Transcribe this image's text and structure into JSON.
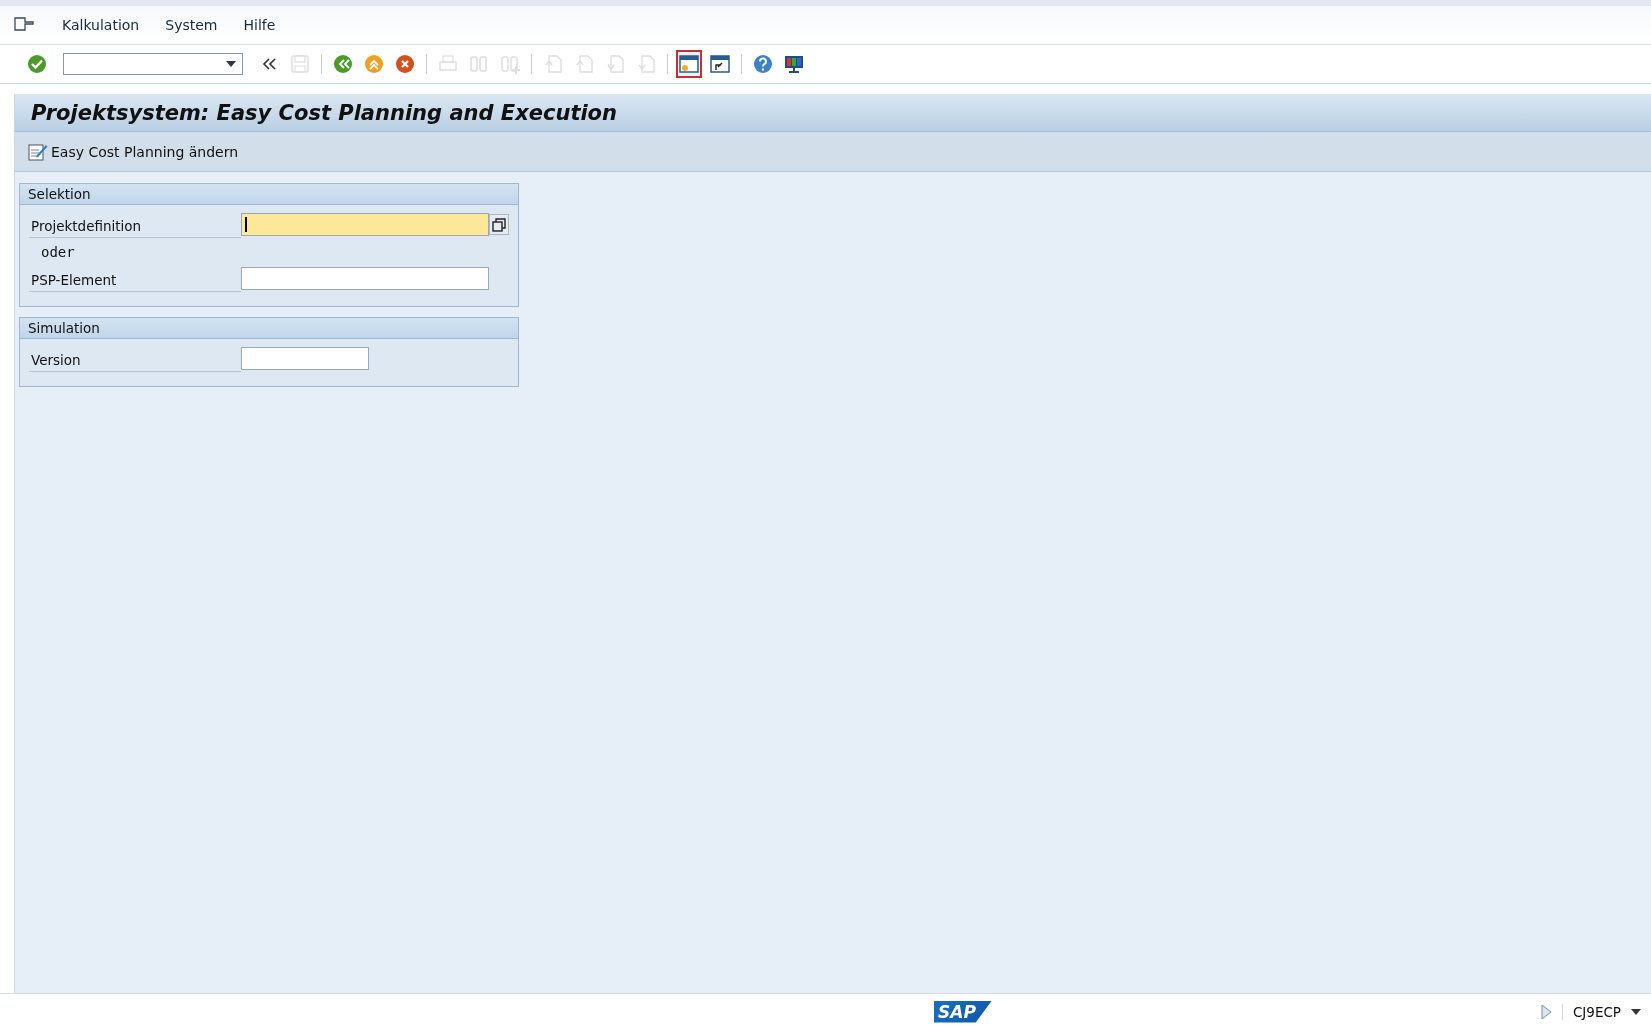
{
  "menu": [
    {
      "label": "Kalkulation"
    },
    {
      "label": "System"
    },
    {
      "label": "Hilfe"
    }
  ],
  "toolbar": [
    {
      "buttons": [
        {
          "kind": "enter",
          "disabled": false,
          "focused": false
        }
      ]
    },
    {
      "buttons": [
        {
          "kind": "collapse",
          "disabled": false,
          "focused": false
        },
        {
          "kind": "save",
          "disabled": true,
          "focused": false
        }
      ]
    },
    {
      "buttons": [
        {
          "kind": "back",
          "disabled": false,
          "focused": false
        },
        {
          "kind": "exit",
          "disabled": false,
          "focused": false
        },
        {
          "kind": "cancel",
          "disabled": false,
          "focused": false
        }
      ]
    },
    {
      "buttons": [
        {
          "kind": "print",
          "disabled": true,
          "focused": false
        },
        {
          "kind": "find",
          "disabled": true,
          "focused": false
        },
        {
          "kind": "find-next",
          "disabled": true,
          "focused": false
        }
      ]
    },
    {
      "buttons": [
        {
          "kind": "first-page",
          "disabled": true,
          "focused": false
        },
        {
          "kind": "prev-page",
          "disabled": true,
          "focused": false
        },
        {
          "kind": "next-page",
          "disabled": true,
          "focused": false
        },
        {
          "kind": "last-page",
          "disabled": true,
          "focused": false
        }
      ]
    },
    {
      "buttons": [
        {
          "kind": "new-session",
          "disabled": false,
          "focused": true
        },
        {
          "kind": "shortcut",
          "disabled": false,
          "focused": false
        }
      ]
    },
    {
      "buttons": [
        {
          "kind": "help",
          "disabled": false,
          "focused": false
        },
        {
          "kind": "layout",
          "disabled": false,
          "focused": false
        }
      ]
    }
  ],
  "title": "Projektsystem: Easy Cost Planning and Execution",
  "app_toolbar": [
    {
      "label": "Easy Cost Planning ändern"
    }
  ],
  "groups": [
    {
      "title": "Selektion",
      "rows": [
        {
          "kind": "field",
          "label": "Projektdefinition",
          "focused": true,
          "value_help": true
        },
        {
          "kind": "text",
          "text": "oder"
        },
        {
          "kind": "field",
          "label": "PSP-Element",
          "focused": false,
          "value_help": false
        }
      ]
    },
    {
      "title": "Simulation",
      "rows": [
        {
          "kind": "code",
          "label": "Version",
          "focused": false,
          "value_help": false
        }
      ]
    }
  ],
  "status_bar": {
    "logo": "SAP",
    "transaction": "CJ9ECP"
  }
}
